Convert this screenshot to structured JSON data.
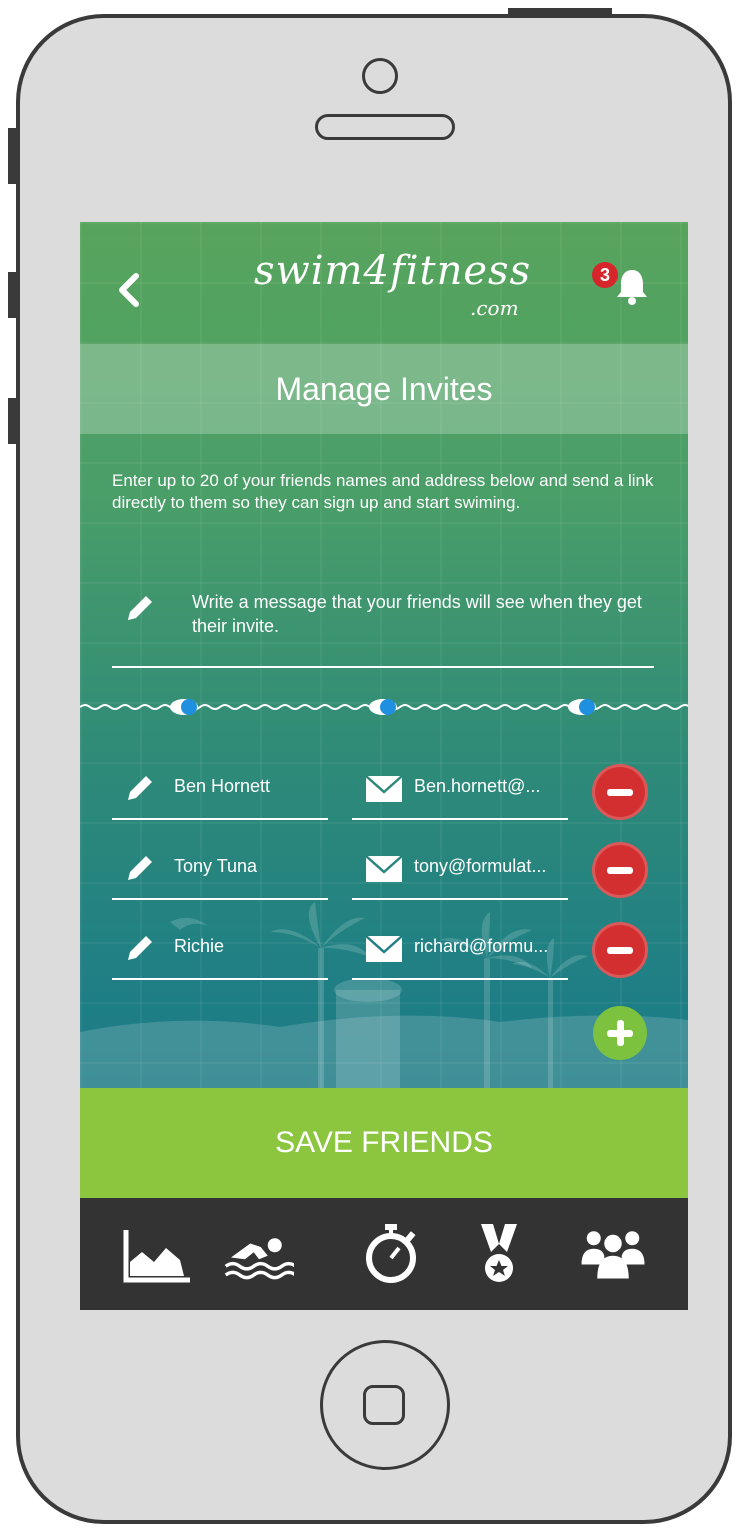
{
  "header": {
    "logo_main": "swim4fitness",
    "logo_sub": ".com",
    "notification_count": "3"
  },
  "page": {
    "title": "Manage Invites",
    "intro": "Enter up to 20 of your friends names and address below and send a link directly to them so they can sign up and start swiming."
  },
  "message": {
    "placeholder": "Write a message that your friends will see when they get their invite."
  },
  "friends": [
    {
      "name": "Ben Hornett",
      "email": "Ben.hornett@..."
    },
    {
      "name": "Tony Tuna",
      "email": "tony@formulat..."
    },
    {
      "name": "Richie",
      "email": "richard@formu..."
    }
  ],
  "save_label": "SAVE FRIENDS",
  "tabs": [
    {
      "icon": "chart-icon"
    },
    {
      "icon": "swimmer-icon"
    },
    {
      "icon": "stopwatch-icon"
    },
    {
      "icon": "medal-icon"
    },
    {
      "icon": "group-icon"
    }
  ],
  "colors": {
    "accent_green": "#8cc63f",
    "remove_red": "#d32f30",
    "add_green": "#7cc23f",
    "tabbar": "#333333"
  }
}
